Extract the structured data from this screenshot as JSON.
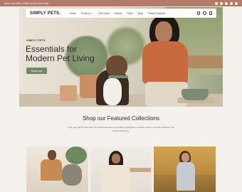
{
  "announcement": {
    "message": "Save now WELCOME for the first order",
    "social_icons": [
      "facebook-icon",
      "instagram-icon",
      "pinterest-icon",
      "tiktok-icon",
      "youtube-icon"
    ]
  },
  "header": {
    "logo": "SIMPLY PETS.",
    "menu": [
      "Home",
      "Products ⌄",
      "Gift Cards",
      "Brands",
      "FAQs",
      "Blog",
      "Theme Features"
    ],
    "icons": [
      "search-icon",
      "account-icon",
      "cart-icon"
    ]
  },
  "hero": {
    "eyebrow": "SIMPLY PETS.",
    "headline": "Essentials for Modern Pet Living",
    "cta": "Shop now"
  },
  "collections": {
    "title": "Shop our Featured Collections",
    "subtitle": "Give your pet the best with our curated selection of products designed to provide comfort, promote wellness, and bring endless joy."
  },
  "colors": {
    "announcement_bg": "#b47a6a",
    "cta_bg": "#6f8a68",
    "page_bg": "#f4f1ec"
  }
}
